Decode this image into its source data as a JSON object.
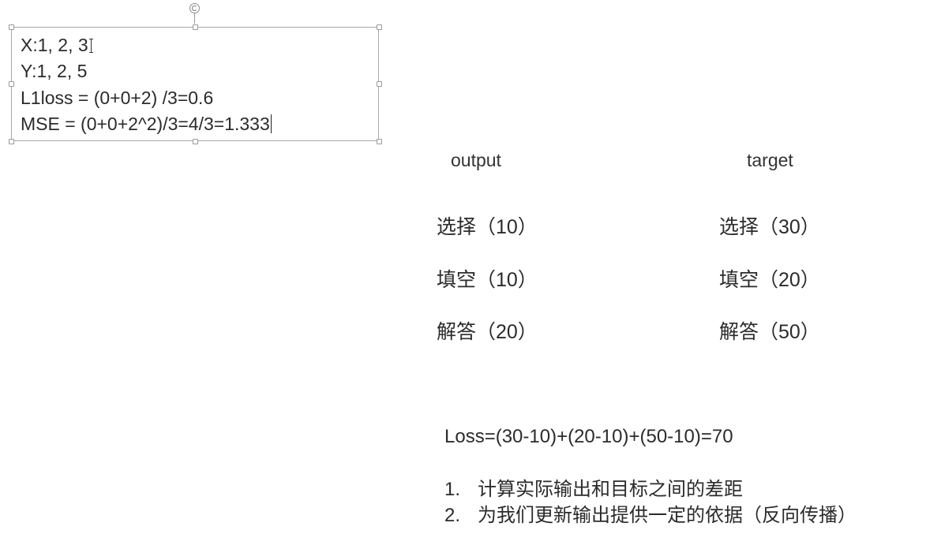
{
  "textbox": {
    "line1": "X:1, 2, 3",
    "line2": "Y:1, 2, 5",
    "line3": "L1loss = (0+0+2) /3=0.6",
    "line4": "MSE = (0+0+2^2)/3=4/3=1.333"
  },
  "table": {
    "headers": {
      "output": "output",
      "target": "target"
    },
    "rows": [
      {
        "output": "选择（10）",
        "target": "选择（30）"
      },
      {
        "output": "填空（10）",
        "target": "填空（20）"
      },
      {
        "output": "解答（20）",
        "target": "解答（50）"
      }
    ]
  },
  "loss_formula": "Loss=(30-10)+(20-10)+(50-10)=70",
  "notes": [
    {
      "num": "1.",
      "text": "计算实际输出和目标之间的差距"
    },
    {
      "num": "2.",
      "text": "为我们更新输出提供一定的依据（反向传播）"
    }
  ]
}
